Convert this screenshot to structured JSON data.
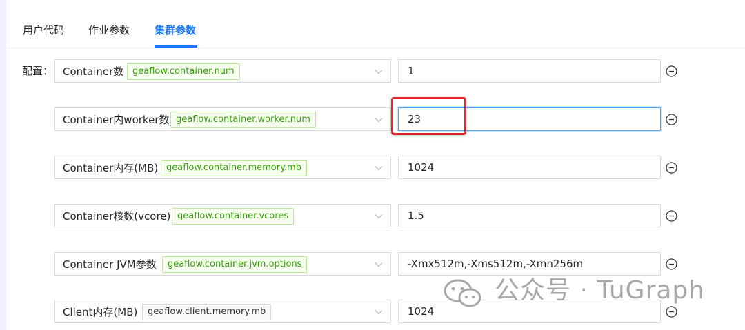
{
  "tabs": [
    {
      "label": "用户代码",
      "active": false
    },
    {
      "label": "作业参数",
      "active": false
    },
    {
      "label": "集群参数",
      "active": true
    }
  ],
  "config_label": "配置：",
  "rows": [
    {
      "name": "Container数",
      "key": "geaflow.container.num",
      "value": "1"
    },
    {
      "name": "Container内worker数",
      "key": "geaflow.container.worker.num",
      "value": "23"
    },
    {
      "name": "Container内存(MB)",
      "key": "geaflow.container.memory.mb",
      "value": "1024"
    },
    {
      "name": "Container核数(vcore)",
      "key": "geaflow.container.vcores",
      "value": "1.5"
    },
    {
      "name": "Container JVM参数",
      "key": "geaflow.container.jvm.options",
      "value": "-Xmx512m,-Xms512m,-Xmn256m"
    },
    {
      "name": "Client内存(MB)",
      "key": "geaflow.client.memory.mb",
      "value": "1024"
    }
  ],
  "watermark": {
    "text": "公众号 · TuGraph",
    "icon": "wechat-icon"
  },
  "icons": {
    "dropdown": "chevron-down-icon",
    "remove": "minus-circle-icon"
  },
  "colors": {
    "accent": "#1677ff",
    "tag_green_text": "#389e0d",
    "tag_green_border": "#b7eb8f",
    "tag_green_bg": "#f6ffed",
    "focus_border": "#40a9ff",
    "annotation_red": "#e8262b"
  }
}
